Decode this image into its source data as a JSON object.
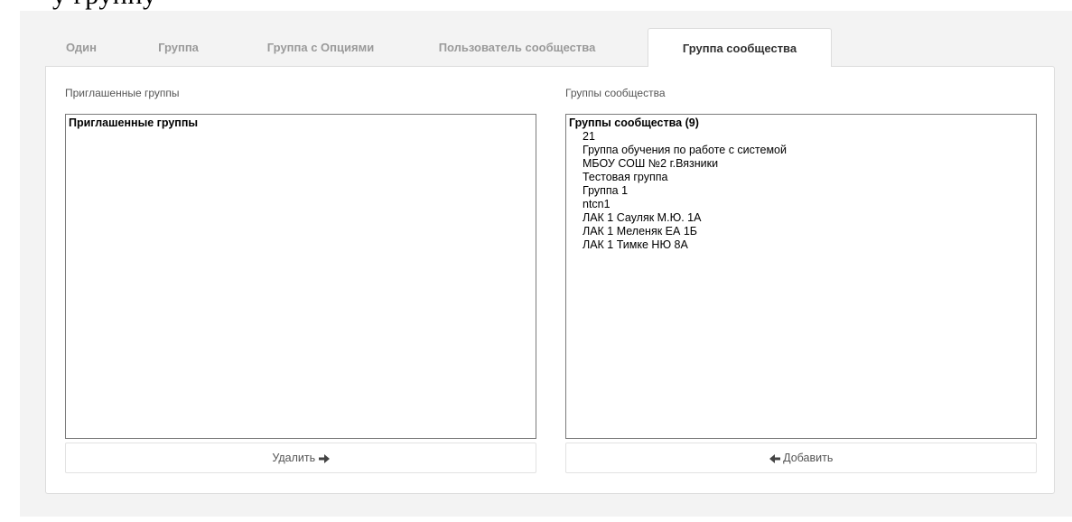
{
  "page_title_fragment": "у группу",
  "tabs": [
    {
      "label": "Один",
      "active": false
    },
    {
      "label": "Группа",
      "active": false
    },
    {
      "label": "Группа с Опциями",
      "active": false
    },
    {
      "label": "Пользователь сообщества",
      "active": false
    },
    {
      "label": "Группа сообщества",
      "active": true
    }
  ],
  "left": {
    "label": "Приглашенные группы",
    "list_title": "Приглашенные группы",
    "items": [],
    "button_label": "Удалить",
    "button_icon": "arrow-right-icon"
  },
  "right": {
    "label": "Группы сообщества",
    "list_title": "Группы сообщества (9)",
    "items": [
      "21",
      "Группа обучения по работе с системой",
      "МБОУ СОШ №2 г.Вязники",
      "Тестовая группа",
      "Группа 1",
      "ntcn1",
      "ЛАК 1 Сауляк М.Ю. 1А",
      "ЛАК 1 Меленяк ЕА 1Б",
      "ЛАК 1 Тимке НЮ 8А"
    ],
    "button_label": "Добавить",
    "button_icon": "arrow-left-icon"
  }
}
